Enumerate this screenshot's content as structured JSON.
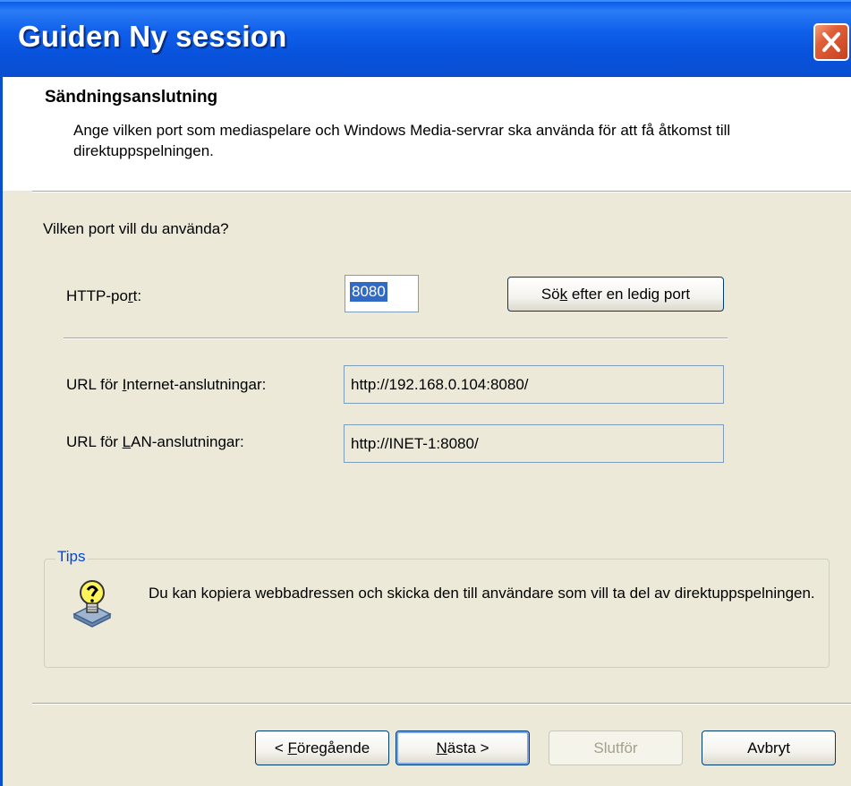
{
  "window": {
    "title": "Guiden Ny session"
  },
  "header": {
    "title": "Sändningsanslutning",
    "subtitle": "Ange vilken port som mediaspelare och Windows Media-servrar ska använda för att få åtkomst till direktuppspelningen."
  },
  "question": "Vilken port vill du använda?",
  "http_port": {
    "label_pre": "HTTP-po",
    "label_key": "r",
    "label_post": "t:",
    "value": "8080"
  },
  "search_button": {
    "pre": "Sö",
    "key": "k",
    "post": " efter en ledig port"
  },
  "internet_url": {
    "label_pre": "URL för ",
    "label_key": "I",
    "label_post": "nternet-anslutningar:",
    "value": "http://192.168.0.104:8080/"
  },
  "lan_url": {
    "label_pre": "URL för ",
    "label_key": "L",
    "label_post": "AN-anslutningar:",
    "value": "http://INET-1:8080/"
  },
  "tips": {
    "legend": "Tips",
    "text": "Du kan kopiera webbadressen och skicka den till användare som vill ta del av direktuppspelningen.",
    "icon": "lightbulb-icon"
  },
  "buttons": {
    "prev": {
      "pre": "< ",
      "key": "F",
      "post": "öregående"
    },
    "next": {
      "pre": "",
      "key": "N",
      "post": "ästa >"
    },
    "finish": "Slutför",
    "cancel": "Avbryt"
  },
  "colors": {
    "titlebar": "#0a5ce8",
    "dialog_bg": "#ece9d8",
    "tips_legend": "#0046d5",
    "close_button": "#e0603a"
  }
}
